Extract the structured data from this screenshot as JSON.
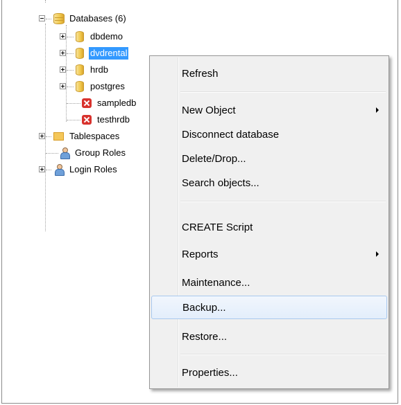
{
  "tree": {
    "databases_label": "Databases (6)",
    "items": [
      "dbdemo",
      "dvdrental",
      "hrdb",
      "postgres",
      "sampledb",
      "testhrdb"
    ],
    "tablespaces": "Tablespaces",
    "group_roles": "Group Roles",
    "login_roles": "Login Roles"
  },
  "menu": {
    "refresh": "Refresh",
    "new_object": "New Object",
    "disconnect": "Disconnect database",
    "delete_drop": "Delete/Drop...",
    "search_objects": "Search objects...",
    "create_script": "CREATE Script",
    "reports": "Reports",
    "maintenance": "Maintenance...",
    "backup": "Backup...",
    "restore": "Restore...",
    "properties": "Properties..."
  },
  "colors": {
    "selection": "#3399ff",
    "menu_bg": "#f0f0f0",
    "hover_border": "#a8c8ee"
  },
  "icons": [
    "database-icon",
    "database-error-icon",
    "tablespaces-icon",
    "group-roles-icon",
    "login-roles-icon",
    "submenu-arrow-icon"
  ]
}
